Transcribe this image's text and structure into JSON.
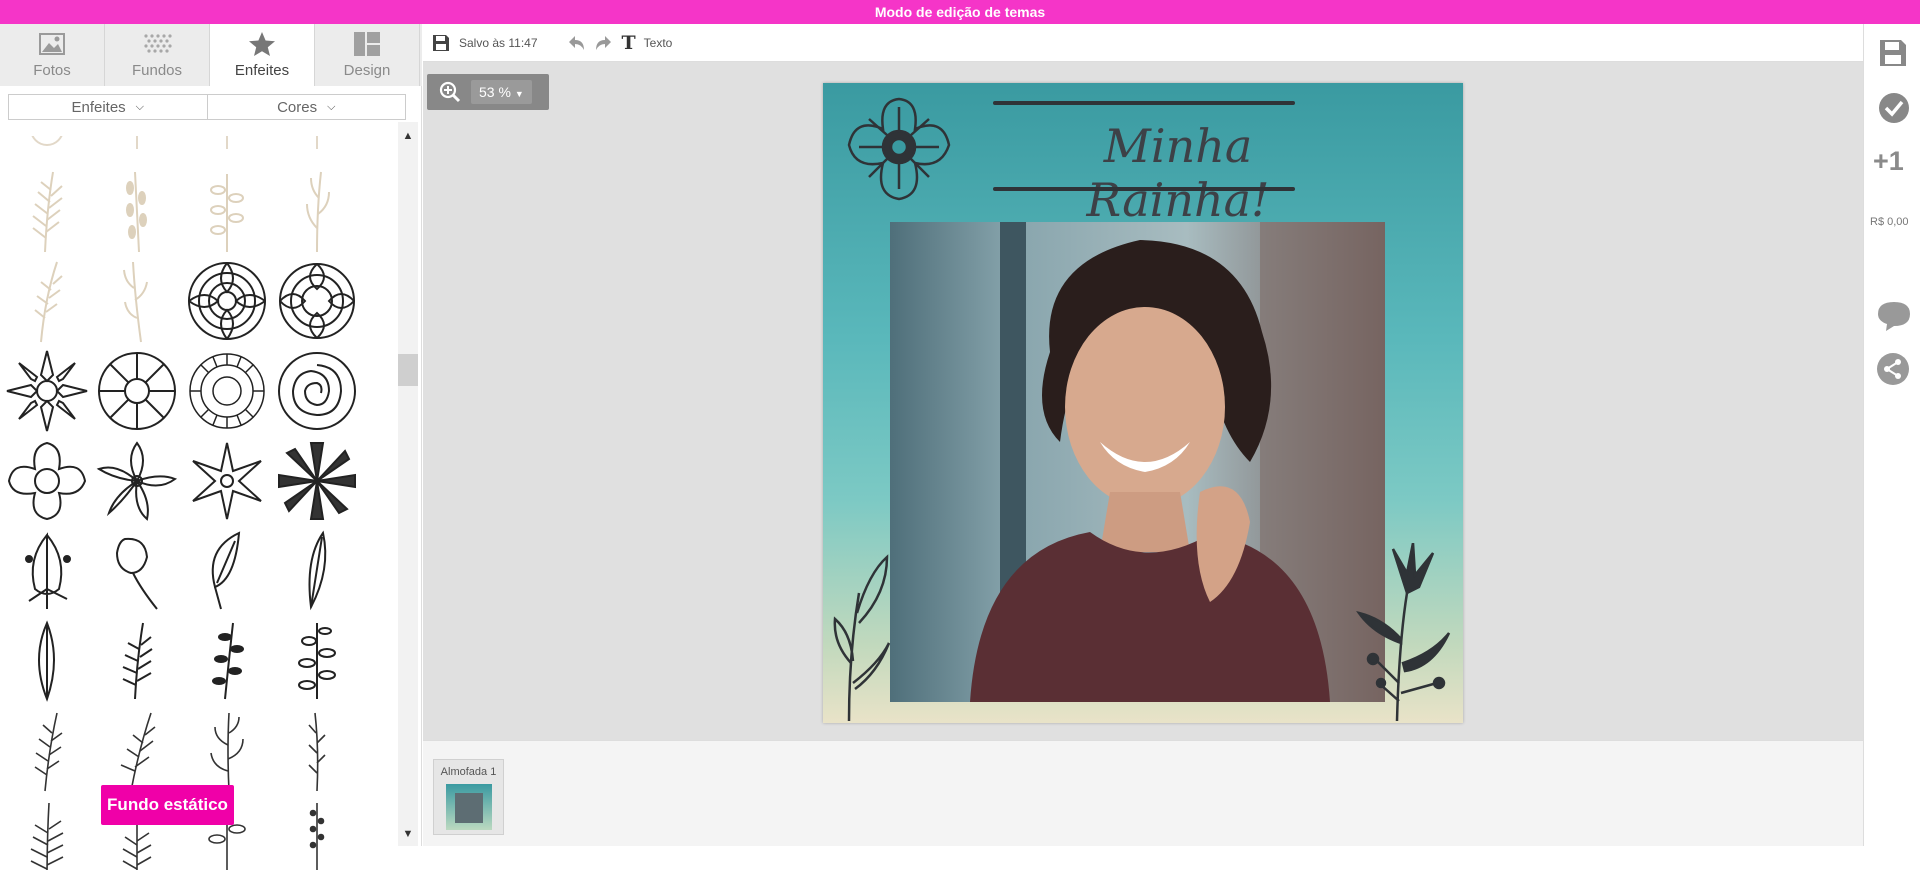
{
  "header": {
    "title": "Modo de edição de temas"
  },
  "left_panel": {
    "tabs": [
      {
        "label": "Fotos",
        "icon": "photo-icon",
        "active": false
      },
      {
        "label": "Fundos",
        "icon": "pattern-icon",
        "active": false
      },
      {
        "label": "Enfeites",
        "icon": "star-icon",
        "active": true
      },
      {
        "label": "Design",
        "icon": "layout-icon",
        "active": false
      }
    ],
    "filters": [
      {
        "label": "Enfeites"
      },
      {
        "label": "Cores"
      }
    ],
    "static_button": "Fundo estático"
  },
  "toolbar": {
    "save_status": "Salvo às 11:47",
    "text_button": "Texto"
  },
  "canvas": {
    "zoom": "53 %",
    "page_title": "Minha Rainha!"
  },
  "pages": [
    {
      "label": "Almofada 1"
    }
  ],
  "right_panel": {
    "plus_label": "+1",
    "price": "R$ 0,00"
  },
  "colors": {
    "header_pink": "#f535c8",
    "button_pink": "#f000a8",
    "page_teal": "#3a9aa1"
  }
}
